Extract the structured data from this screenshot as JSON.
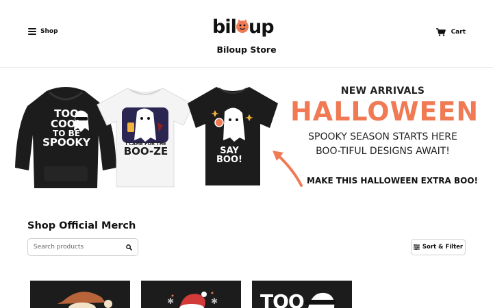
{
  "header": {
    "shop_label": "Shop",
    "cart_label": "Cart",
    "logo_text": "biloup",
    "store_name": "Biloup Store"
  },
  "banner": {
    "shirts": [
      {
        "lines": [
          "TOO",
          "COOL",
          "TO BE",
          "SPOOKY"
        ]
      },
      {
        "lines": [
          "I CAME FOR THE",
          "BOO-ZE"
        ]
      },
      {
        "lines": [
          "SAY BOO!"
        ]
      }
    ],
    "subtitle": "NEW ARRIVALS",
    "title": "HALLOWEEN",
    "line1": "SPOOKY SEASON STARTS HERE",
    "line2": "BOO-TIFUL DESIGNS AWAIT!",
    "cta": "MAKE THIS HALLOWEEN EXTRA BOO!"
  },
  "shop": {
    "title": "Shop Official Merch",
    "search_placeholder": "Search products",
    "sort_label": "Sort & Filter"
  },
  "products": [
    {
      "art": "cowboy-ghost"
    },
    {
      "art": "santa-ghost"
    },
    {
      "art_text": "TOO"
    }
  ],
  "colors": {
    "accent": "#ef7a54",
    "dark": "#111111",
    "shirt_black": "#1c1c1c",
    "shirt_white": "#f4f4f4"
  }
}
